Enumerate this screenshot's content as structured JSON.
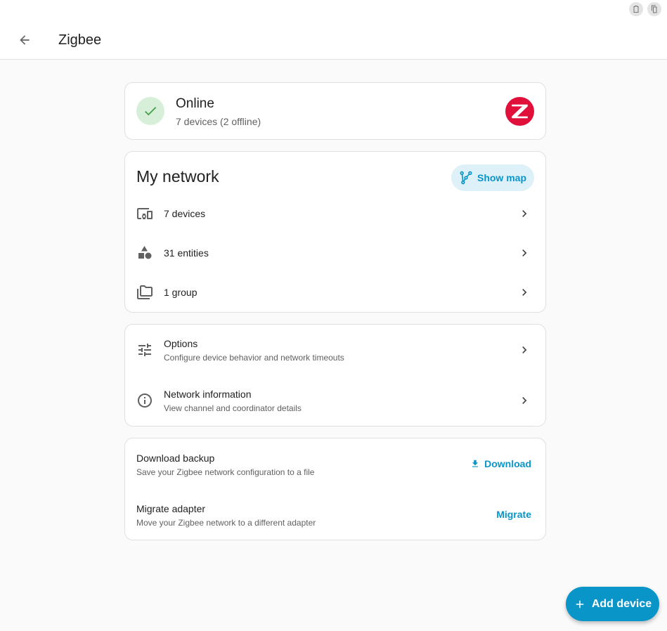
{
  "header": {
    "title": "Zigbee"
  },
  "status": {
    "title": "Online",
    "subtitle": "7 devices (2 offline)"
  },
  "network": {
    "title": "My network",
    "show_map_label": "Show map",
    "items": [
      {
        "label": "7 devices",
        "icon": "devices-icon"
      },
      {
        "label": "31 entities",
        "icon": "shapes-icon"
      },
      {
        "label": "1 group",
        "icon": "folders-icon"
      }
    ]
  },
  "settings": {
    "items": [
      {
        "label": "Options",
        "description": "Configure device behavior and network timeouts",
        "icon": "tune-icon"
      },
      {
        "label": "Network information",
        "description": "View channel and coordinator details",
        "icon": "info-icon"
      }
    ]
  },
  "backup": {
    "download": {
      "title": "Download backup",
      "description": "Save your Zigbee network configuration to a file",
      "button": "Download"
    },
    "migrate": {
      "title": "Migrate adapter",
      "description": "Move your Zigbee network to a different adapter",
      "button": "Migrate"
    }
  },
  "fab": {
    "label": "Add device"
  },
  "colors": {
    "accent": "#0a95c9",
    "online_bg": "#d7efd8",
    "online_check": "#43a047",
    "zigbee_red": "#e0103b"
  }
}
